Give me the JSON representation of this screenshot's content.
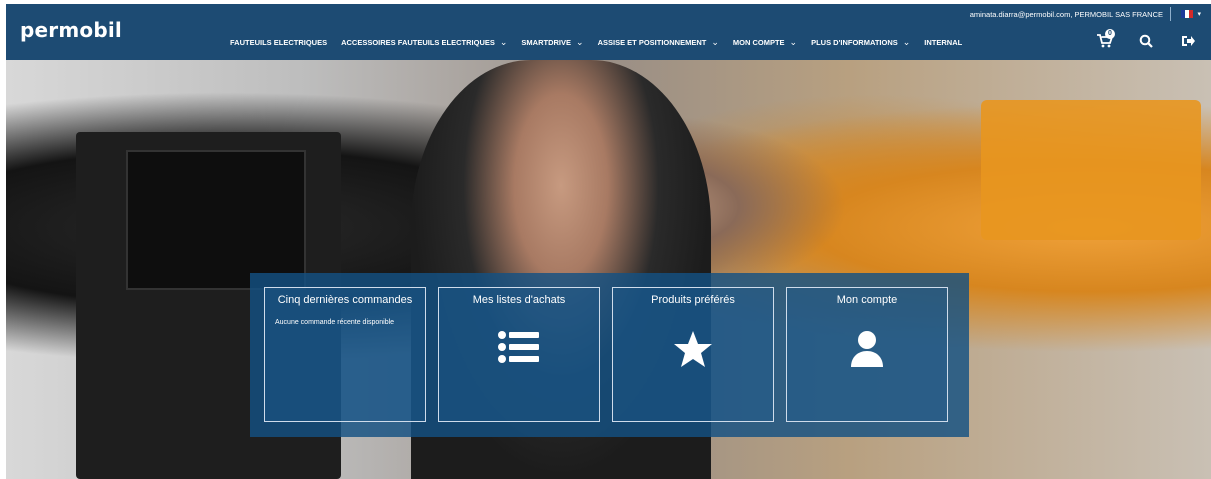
{
  "header": {
    "brand": "permobil",
    "user_line": "aminata.diarra@permobil.com, PERMOBIL SAS FRANCE",
    "cart_count": "0",
    "flag_colors": [
      "#1e3a9a",
      "#ffffff",
      "#d42a2a"
    ],
    "icons": [
      "shopping-cart-icon",
      "search-icon",
      "sign-out-icon",
      "chevron-down-icon"
    ]
  },
  "nav": [
    {
      "label": "FAUTEUILS ELECTRIQUES",
      "has_menu": false
    },
    {
      "label": "ACCESSOIRES FAUTEUILS ELECTRIQUES",
      "has_menu": true
    },
    {
      "label": "SMARTDRIVE",
      "has_menu": true
    },
    {
      "label": "ASSISE ET POSITIONNEMENT",
      "has_menu": true
    },
    {
      "label": "MON COMPTE",
      "has_menu": true
    },
    {
      "label": "PLUS D'INFORMATIONS",
      "has_menu": true
    },
    {
      "label": "INTERNAL",
      "has_menu": false
    }
  ],
  "tiles": [
    {
      "title": "Cinq dernières commandes",
      "body": "Aucune commande récente disponible",
      "icon": ""
    },
    {
      "title": "Mes listes d'achats",
      "body": "",
      "icon": "list-icon"
    },
    {
      "title": "Produits préférés",
      "body": "",
      "icon": "star-icon"
    },
    {
      "title": "Mon compte",
      "body": "",
      "icon": "user-icon"
    }
  ],
  "colors": {
    "header_bg": "#1d4b73",
    "panel_bg": "#14508299",
    "text": "#ffffff"
  }
}
